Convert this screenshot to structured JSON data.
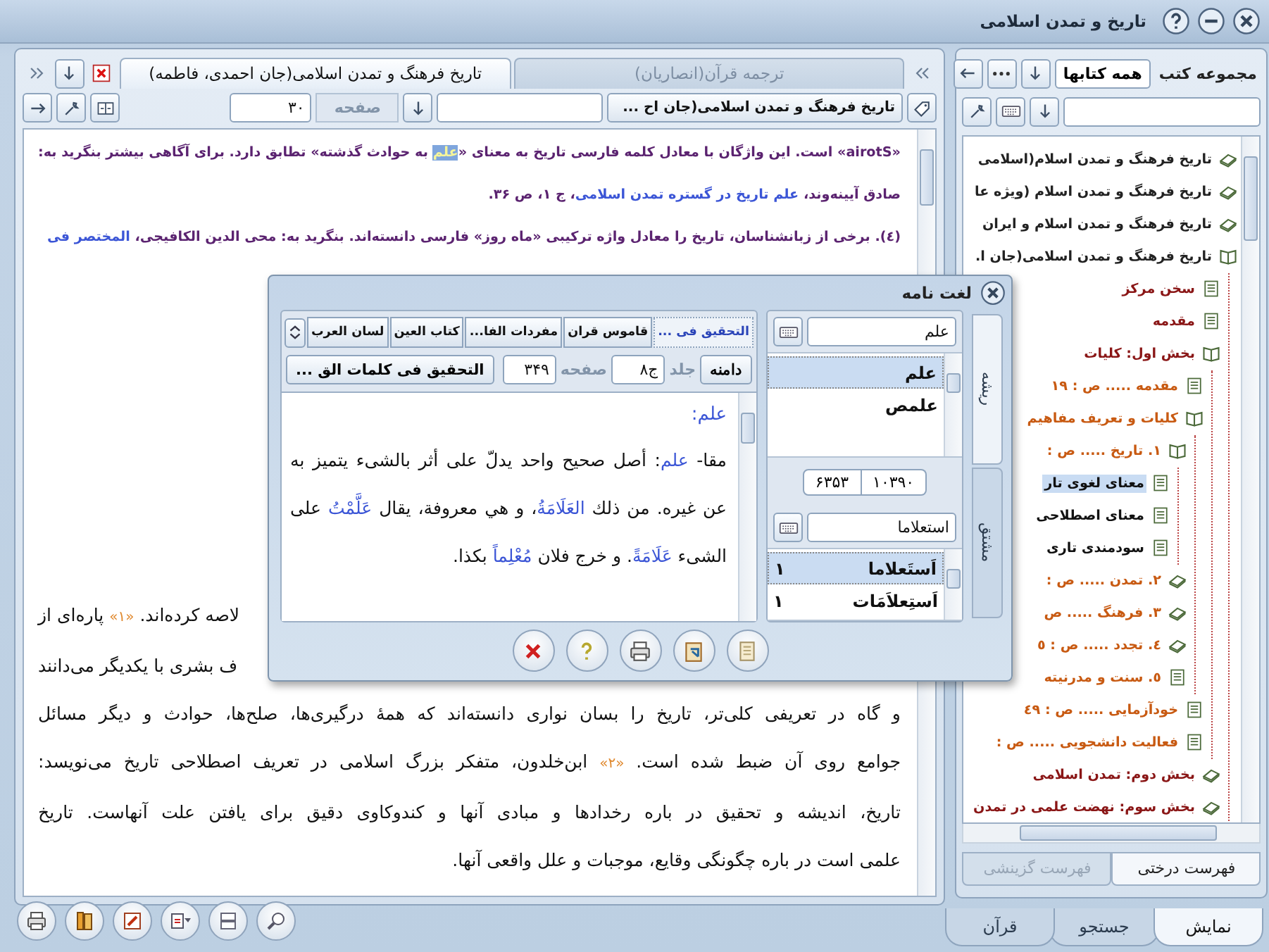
{
  "window": {
    "title": "تاریخ و تمدن اسلامی"
  },
  "reader": {
    "tabs": [
      {
        "label": "ترجمه قرآن(انصاریان)",
        "selected": false
      },
      {
        "label": "تاریخ فرهنگ و تمدن اسلامی(جان احمدی، فاطمه)",
        "selected": true
      }
    ],
    "book_selector": "تاریخ فرهنگ و تمدن اسلامی(جان اح ...",
    "page_label": "صفحه",
    "page": "۳۰",
    "lines": [
      {
        "kind": "footnote",
        "runs": [
          {
            "kind": "plain",
            "text": "«airotS» است. این واژگان با معادل کلمه فارسی تاریخ به معنای «"
          },
          {
            "kind": "highlight",
            "text": "علم"
          },
          {
            "kind": "plain",
            "text": " به حوادث گذشته» تطابق دارد. برای آگاهی بیشتر بنگرید به:"
          }
        ]
      },
      {
        "kind": "footnote",
        "runs": [
          {
            "kind": "plain",
            "text": "صادق آیینه‌وند، "
          },
          {
            "kind": "link",
            "text": "علم تاریخ در گستره تمدن اسلامی"
          },
          {
            "kind": "plain",
            "text": "، ج ۱، ص ۳۶."
          }
        ]
      },
      {
        "kind": "footnote",
        "runs": [
          {
            "kind": "plain",
            "text": "(٤). برخی از زبانشناسان، تاریخ را معادل واژه ترکیبی «ماه روز» فارسی دانسته‌اند. بنگرید به: محی الدین الکافیجی، "
          },
          {
            "kind": "link",
            "text": "المختصر فی"
          }
        ]
      },
      {
        "kind": "fragment",
        "runs": [
          {
            "kind": "plain",
            "text": "لاصه کرده‌اند. "
          },
          {
            "kind": "ref",
            "text": "«۱»"
          },
          {
            "kind": "plain",
            "text": " پاره‌ای از"
          }
        ]
      },
      {
        "kind": "fragment",
        "runs": [
          {
            "kind": "plain",
            "text": "ف بشری با یکدیگر می‌دانند"
          }
        ]
      },
      {
        "kind": "body",
        "runs": [
          {
            "kind": "plain",
            "text": "و گاه در تعریفی کلی‌تر، تاریخ را بسان نواری دانسته‌اند که همهٔ درگیری‌ها، صلح‌ها، حوادث و دیگر مسائل"
          }
        ]
      },
      {
        "kind": "body",
        "runs": [
          {
            "kind": "plain",
            "text": "جوامع روی آن ضبط شده است. "
          },
          {
            "kind": "ref",
            "text": "«۲»"
          },
          {
            "kind": "plain",
            "text": " ابن‌خلدون، متفکر بزرگ اسلامی در تعریف اصطلاحی تاریخ می‌نویسد:"
          }
        ]
      },
      {
        "kind": "body",
        "runs": [
          {
            "kind": "plain",
            "text": "تاریخ، اندیشه و تحقیق در باره رخدادها و مبادی آنها و کندوکاوی دقیق برای یافتن علت آنهاست. تاریخ"
          }
        ]
      },
      {
        "kind": "body",
        "runs": [
          {
            "kind": "plain",
            "text": "علمی است در باره چگونگی وقایع، موجبات و علل واقعی آنها."
          }
        ]
      }
    ]
  },
  "library": {
    "collection_label": "مجموعه کتب",
    "collection": "همه کتابها",
    "tree": [
      {
        "label": "تاریخ فرهنگ و تمدن اسلام(اسلامی",
        "kind": "book",
        "expanded": false,
        "selected": false
      },
      {
        "label": "تاریخ فرهنگ و تمدن اسلام (ویژه عا",
        "kind": "book",
        "expanded": false,
        "selected": false
      },
      {
        "label": "تاریخ فرهنگ و تمدن اسلام و ایران",
        "kind": "book",
        "expanded": false,
        "selected": false
      },
      {
        "label": "تاریخ فرهنگ و تمدن اسلامی(جان ا.",
        "kind": "book",
        "expanded": true,
        "selected": false,
        "children": [
          {
            "label": "سخن مرکز",
            "kind": "page",
            "selected": false
          },
          {
            "label": "مقدمه",
            "kind": "page",
            "selected": false
          },
          {
            "label": "بخش اول: کلیات",
            "kind": "book",
            "expanded": true,
            "selected": false,
            "children": [
              {
                "label": "مقدمه ..... ص : ۱۹",
                "kind": "page",
                "selected": false
              },
              {
                "label": "کلیات و تعریف مفاهیم",
                "kind": "book",
                "expanded": true,
                "selected": false,
                "children": [
                  {
                    "label": "۱. تاریخ ..... ص :",
                    "kind": "book",
                    "expanded": true,
                    "selected": false,
                    "children": [
                      {
                        "label": "معنای لغوی تار",
                        "kind": "page",
                        "selected": true
                      },
                      {
                        "label": "معنای اصطلاحی",
                        "kind": "page",
                        "selected": false
                      },
                      {
                        "label": "سودمندی تاری",
                        "kind": "page",
                        "selected": false
                      }
                    ]
                  },
                  {
                    "label": "۲. تمدن ..... ص :",
                    "kind": "book",
                    "expanded": false,
                    "selected": false
                  },
                  {
                    "label": "۳. فرهنگ ..... ص",
                    "kind": "book",
                    "expanded": false,
                    "selected": false
                  },
                  {
                    "label": "٤. تجدد ..... ص : ٥",
                    "kind": "book",
                    "expanded": false,
                    "selected": false
                  },
                  {
                    "label": "٥. سنت و مدرنیته",
                    "kind": "page",
                    "selected": false
                  }
                ]
              },
              {
                "label": "خودآزمایی ..... ص : ٤٩",
                "kind": "page",
                "selected": false
              },
              {
                "label": "فعالیت دانشجویی ..... ص :",
                "kind": "page",
                "selected": false
              }
            ]
          },
          {
            "label": "بخش دوم: تمدن اسلامی",
            "kind": "book",
            "expanded": false,
            "selected": false
          },
          {
            "label": "بخش سوم: نهضت علمی در تمدن",
            "kind": "book",
            "expanded": false,
            "selected": false
          }
        ]
      }
    ],
    "tabs": [
      {
        "label": "فهرست درختی",
        "selected": true
      },
      {
        "label": "فهرست گزینشی",
        "selected": false
      }
    ]
  },
  "dictionary": {
    "title": "لغت نامه",
    "side_tabs": [
      {
        "label": "ریشه",
        "selected": true
      },
      {
        "label": "مشتق",
        "selected": false
      }
    ],
    "root_query": "علم",
    "roots": [
      {
        "label": "علم",
        "selected": true
      },
      {
        "label": "علمص",
        "selected": false
      }
    ],
    "counts": [
      "۱۰۳۹۰",
      "۶۳۵۳"
    ],
    "derived_query": "استعلاما",
    "derived": [
      {
        "label": "اَستَعلاما",
        "count": "۱",
        "selected": true
      },
      {
        "label": "اَستِعلاَمَات",
        "count": "۱",
        "selected": false
      }
    ],
    "sources": [
      {
        "label": "التحقیق فی ...",
        "selected": true
      },
      {
        "label": "قاموس قران",
        "selected": false
      },
      {
        "label": "مفردات الفا...",
        "selected": false
      },
      {
        "label": "کتاب العین",
        "selected": false
      },
      {
        "label": "لسان العرب",
        "selected": false
      }
    ],
    "scope_button": "دامنه",
    "volume_label": "جلد",
    "volume": "ج۸",
    "page_label": "صفحه",
    "page": "۳۴۹",
    "source_title": "التحقیق فی کلمات الق ...",
    "entry_heading": "علم:",
    "entry": [
      {
        "kind": "plain",
        "text": "مقا- "
      },
      {
        "kind": "link",
        "text": "علم"
      },
      {
        "kind": "plain",
        "text": ": أصل صحیح واحد یدلّ على أثر بالشیء یتمیز به عن غیره. من ذلك "
      },
      {
        "kind": "link",
        "text": "العَلَامَةُ"
      },
      {
        "kind": "plain",
        "text": "، و هي معروفة، یقال "
      },
      {
        "kind": "link",
        "text": "عَلَّمْتُ"
      },
      {
        "kind": "plain",
        "text": " على الشیء "
      },
      {
        "kind": "link",
        "text": "عَلَامَةً"
      },
      {
        "kind": "plain",
        "text": ". و خرج فلان "
      },
      {
        "kind": "link",
        "text": "مُعْلِماً"
      },
      {
        "kind": "plain",
        "text": " بكذا."
      }
    ]
  },
  "bottom_tabs": [
    {
      "label": "نمایش",
      "selected": true
    },
    {
      "label": "جستجو",
      "selected": false
    },
    {
      "label": "قرآن",
      "selected": false
    }
  ]
}
